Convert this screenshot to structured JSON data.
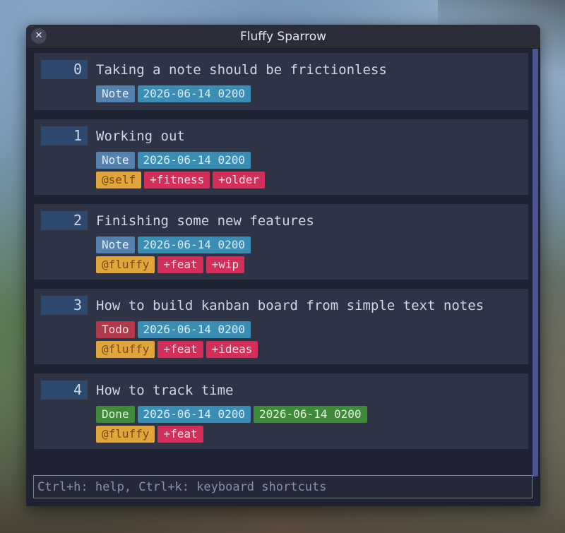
{
  "window": {
    "title": "Fluffy Sparrow",
    "close_label": "✕"
  },
  "notes": [
    {
      "index": "0",
      "title": "Taking a note should be frictionless",
      "rows": [
        [
          {
            "text": "Note",
            "kind": "note"
          },
          {
            "text": "2026-06-14 0200",
            "kind": "date"
          }
        ]
      ]
    },
    {
      "index": "1",
      "title": "Working out",
      "rows": [
        [
          {
            "text": "Note",
            "kind": "note"
          },
          {
            "text": "2026-06-14 0200",
            "kind": "date"
          }
        ],
        [
          {
            "text": "@self",
            "kind": "context"
          },
          {
            "text": "+fitness",
            "kind": "project"
          },
          {
            "text": "+older",
            "kind": "project"
          }
        ]
      ]
    },
    {
      "index": "2",
      "title": "Finishing some new features",
      "rows": [
        [
          {
            "text": "Note",
            "kind": "note"
          },
          {
            "text": "2026-06-14 0200",
            "kind": "date"
          }
        ],
        [
          {
            "text": "@fluffy",
            "kind": "context"
          },
          {
            "text": "+feat",
            "kind": "project"
          },
          {
            "text": "+wip",
            "kind": "project"
          }
        ]
      ]
    },
    {
      "index": "3",
      "title": "How to build kanban board from simple text notes",
      "rows": [
        [
          {
            "text": "Todo",
            "kind": "todo"
          },
          {
            "text": "2026-06-14 0200",
            "kind": "date"
          }
        ],
        [
          {
            "text": "@fluffy",
            "kind": "context"
          },
          {
            "text": "+feat",
            "kind": "project"
          },
          {
            "text": "+ideas",
            "kind": "project"
          }
        ]
      ]
    },
    {
      "index": "4",
      "title": "How to track time",
      "rows": [
        [
          {
            "text": "Done",
            "kind": "done"
          },
          {
            "text": "2026-06-14 0200",
            "kind": "date"
          },
          {
            "text": "2026-06-14 0200",
            "kind": "date-done"
          }
        ],
        [
          {
            "text": "@fluffy",
            "kind": "context"
          },
          {
            "text": "+feat",
            "kind": "project"
          }
        ]
      ]
    }
  ],
  "command": {
    "value": "",
    "placeholder": "Ctrl+h: help, Ctrl+k: keyboard shortcuts"
  },
  "colors": {
    "note": "#5581ad",
    "todo": "#b0394c",
    "done": "#3f8a3a",
    "date": "#3b8db3",
    "context": "#e0a53c",
    "project": "#d2305a"
  },
  "icons": {
    "close": "close-icon"
  }
}
